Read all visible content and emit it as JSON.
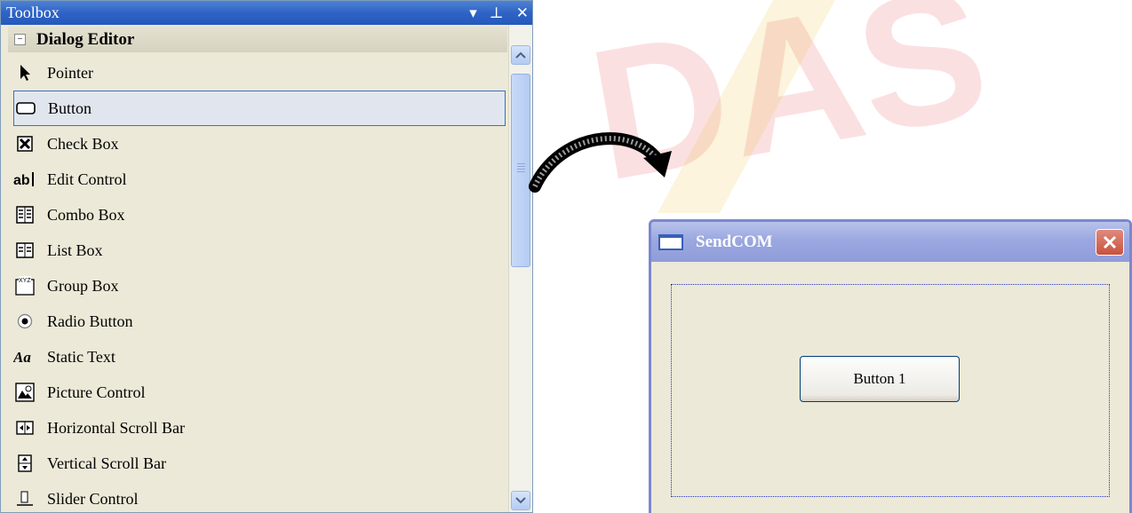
{
  "toolbox": {
    "title": "Toolbox",
    "controls": {
      "dropdown": "▾",
      "pin": "⊥",
      "close": "✕"
    },
    "group": {
      "toggle": "−",
      "label": "Dialog Editor"
    },
    "items": [
      {
        "label": "Pointer",
        "icon": "pointer-icon"
      },
      {
        "label": "Button",
        "icon": "button-icon",
        "selected": true
      },
      {
        "label": "Check Box",
        "icon": "checkbox-icon"
      },
      {
        "label": "Edit Control",
        "icon": "edit-control-icon"
      },
      {
        "label": "Combo Box",
        "icon": "combo-box-icon"
      },
      {
        "label": "List Box",
        "icon": "list-box-icon"
      },
      {
        "label": "Group Box",
        "icon": "group-box-icon"
      },
      {
        "label": "Radio Button",
        "icon": "radio-button-icon"
      },
      {
        "label": "Static Text",
        "icon": "static-text-icon"
      },
      {
        "label": "Picture Control",
        "icon": "picture-control-icon"
      },
      {
        "label": "Horizontal Scroll Bar",
        "icon": "hscroll-icon"
      },
      {
        "label": "Vertical Scroll Bar",
        "icon": "vscroll-icon"
      },
      {
        "label": "Slider Control",
        "icon": "slider-icon"
      }
    ]
  },
  "dialog": {
    "title": "SendCOM",
    "button_label": "Button 1"
  },
  "watermark": {
    "text": "DAS",
    "color": "#e8414a"
  },
  "colors": {
    "accent": "#2f63c4",
    "selection_border": "#3c6fbf",
    "dialog_title": "#9ba8e0",
    "close": "#c8523e"
  }
}
